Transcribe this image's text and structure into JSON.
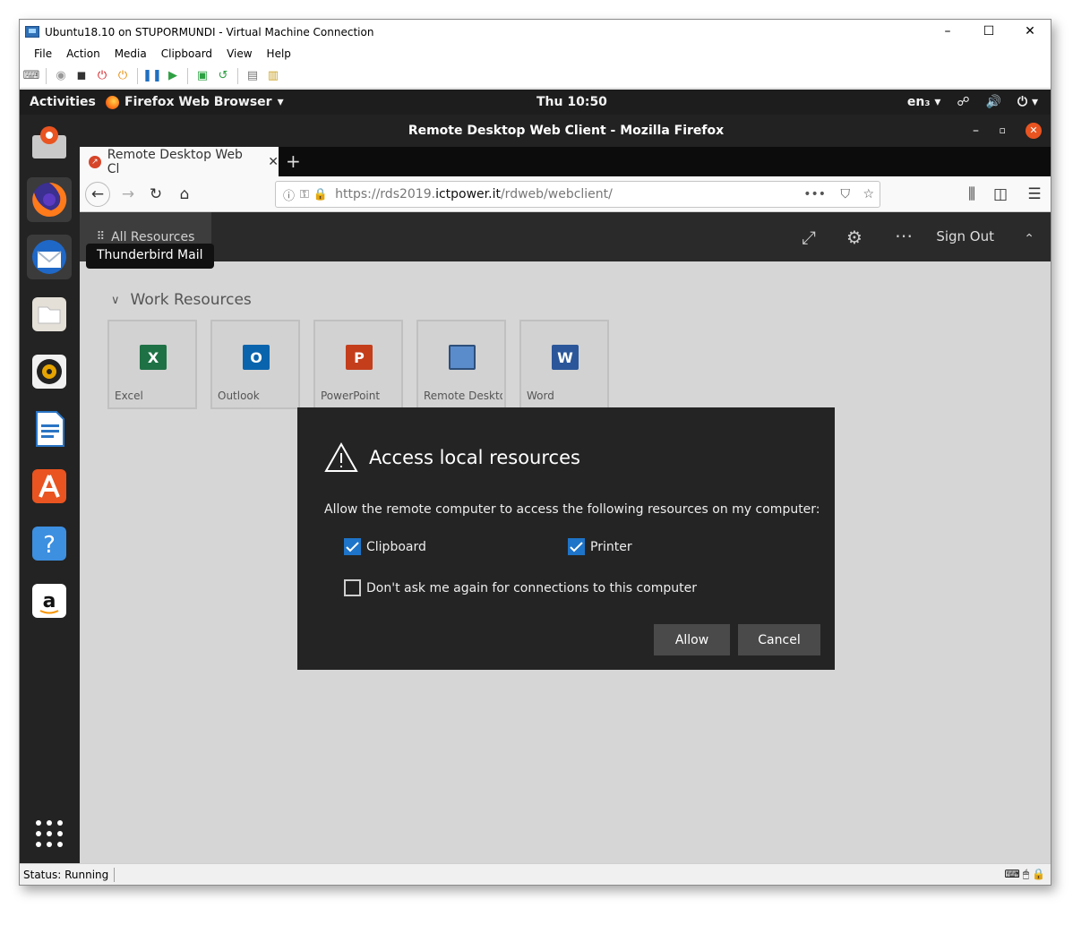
{
  "window": {
    "title": "Ubuntu18.10 on STUPORMUNDI - Virtual Machine Connection",
    "controls": [
      "–",
      "☐",
      "✕"
    ]
  },
  "menu": [
    "File",
    "Action",
    "Media",
    "Clipboard",
    "View",
    "Help"
  ],
  "status": {
    "text": "Status: Running"
  },
  "ubuntu": {
    "activities": "Activities",
    "app_menu": "Firefox Web Browser",
    "clock": "Thu 10:50",
    "lang": "en₃"
  },
  "dock": {
    "tooltip": "Thunderbird Mail"
  },
  "firefox": {
    "title": "Remote Desktop Web Client - Mozilla Firefox",
    "tab_title": "Remote Desktop Web Cl",
    "url_prefix": "https://rds2019.",
    "url_domain": "ictpower.it",
    "url_path": "/rdweb/webclient/"
  },
  "rdweb": {
    "all_resources": "All Resources",
    "sign_out": "Sign Out",
    "group_title": "Work Resources",
    "tiles": [
      {
        "label": "Excel",
        "letter": "X",
        "color": "#1e7145"
      },
      {
        "label": "Outlook",
        "letter": "O",
        "color": "#0a64ad"
      },
      {
        "label": "PowerPoint",
        "letter": "P",
        "color": "#c43e1c"
      },
      {
        "label": "Remote Deskto...",
        "letter": "",
        "color": "#5a8ccc"
      },
      {
        "label": "Word",
        "letter": "W",
        "color": "#2b579a"
      }
    ]
  },
  "dialog": {
    "title": "Access local resources",
    "message": "Allow the remote computer to access the following resources on my computer:",
    "clipboard_label": "Clipboard",
    "clipboard_checked": true,
    "printer_label": "Printer",
    "printer_checked": true,
    "dont_ask_label": "Don't ask me again for connections to this computer",
    "dont_ask_checked": false,
    "allow_label": "Allow",
    "cancel_label": "Cancel"
  }
}
